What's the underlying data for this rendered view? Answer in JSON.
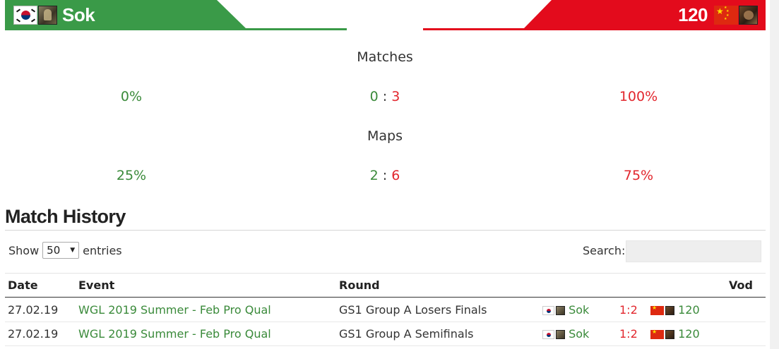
{
  "header": {
    "left_player": {
      "name": "Sok",
      "flag_icon": "south-korea-flag-icon",
      "race_icon": "human-race-icon",
      "color": "#3a9a48"
    },
    "right_player": {
      "name": "120",
      "flag_icon": "china-flag-icon",
      "race_icon": "orc-race-icon",
      "color": "#e30b1c"
    }
  },
  "stats": {
    "matches": {
      "label": "Matches",
      "left_pct": "0%",
      "left_score": "0",
      "separator": ":",
      "right_score": "3",
      "right_pct": "100%"
    },
    "maps": {
      "label": "Maps",
      "left_pct": "25%",
      "left_score": "2",
      "separator": ":",
      "right_score": "6",
      "right_pct": "75%"
    }
  },
  "match_history": {
    "title": "Match History",
    "show_label": "Show",
    "entries_value": "50",
    "entries_label": "entries",
    "search_label": "Search:",
    "search_value": "",
    "columns": [
      "Date",
      "Event",
      "Round",
      "Vod"
    ],
    "rows": [
      {
        "date": "27.02.19",
        "event": "WGL 2019 Summer - Feb Pro Qual",
        "round": "GS1 Group A Losers Finals",
        "player1": "Sok",
        "score": "1:2",
        "player2": "120",
        "vod": ""
      },
      {
        "date": "27.02.19",
        "event": "WGL 2019 Summer - Feb Pro Qual",
        "round": "GS1 Group A Semifinals",
        "player1": "Sok",
        "score": "1:2",
        "player2": "120",
        "vod": ""
      }
    ]
  },
  "colors": {
    "win": "#3a8a3a",
    "loss": "#e2262d"
  }
}
